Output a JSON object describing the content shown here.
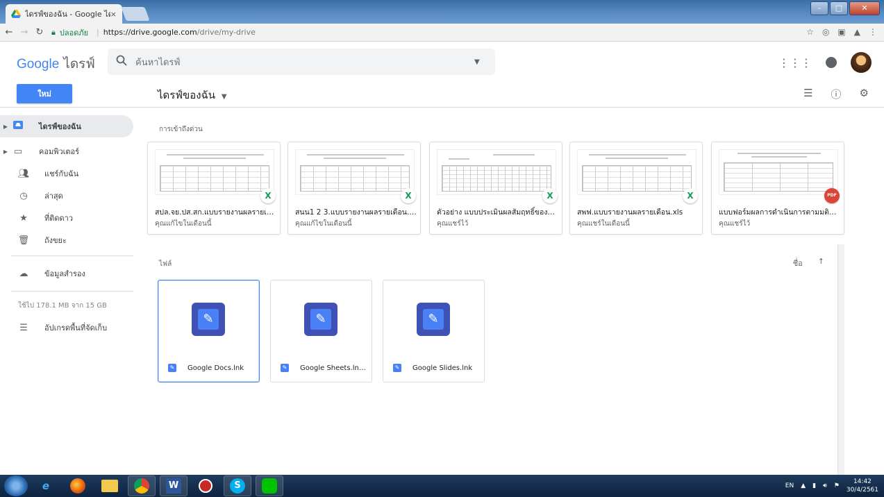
{
  "browser": {
    "tab_title": "ไดรฟ์ของฉัน - Google ไดร",
    "tab_close": "×",
    "secure_label": "ปลอดภัย",
    "url_host": "https://drive.google.com",
    "url_path": "/drive/my-drive"
  },
  "header": {
    "logo_google": "Google",
    "logo_drive": "ไดรฟ์",
    "search_placeholder": "ค้นหาไดรฟ์"
  },
  "toolbar": {
    "new_button": "ใหม่",
    "title": "ไดรฟ์ของฉัน"
  },
  "sidebar": {
    "items": [
      {
        "label": "ไดรฟ์ของฉัน",
        "icon": "drive-icon"
      },
      {
        "label": "คอมพิวเตอร์",
        "icon": "computer-icon"
      },
      {
        "label": "แชร์กับฉัน",
        "icon": "people-icon"
      },
      {
        "label": "ล่าสุด",
        "icon": "clock-icon"
      },
      {
        "label": "ที่ติดดาว",
        "icon": "star-icon"
      },
      {
        "label": "ถังขยะ",
        "icon": "trash-icon"
      }
    ],
    "backup_label": "ข้อมูลสำรอง",
    "storage_text": "ใช้ไป 178.1 MB จาก 15 GB",
    "upgrade_label": "อัปเกรดพื้นที่จัดเก็บ"
  },
  "quick_access": {
    "label": "การเข้าถึงด่วน",
    "cards": [
      {
        "name": "สปล.จย.ปส.สก.แบบรายงานผลรายเดือ...",
        "sub": "คุณแก้ไขในเดือนนี้",
        "badge": "X",
        "type": "sheet"
      },
      {
        "name": "สนน1 2 3.แบบรายงานผลรายเดือน.xls",
        "sub": "คุณแก้ไขในเดือนนี้",
        "badge": "X",
        "type": "sheet"
      },
      {
        "name": "ตัวอย่าง แบบประเมินผลสัมฤทธิ์ของงา...",
        "sub": "คุณแชร์ไว้",
        "badge": "X",
        "type": "sheet"
      },
      {
        "name": "สพฟ.แบบรายงานผลรายเดือน.xls",
        "sub": "คุณแชร์ในเดือนนี้",
        "badge": "X",
        "type": "sheet"
      },
      {
        "name": "แบบฟอร์มผลการดำเนินการตามมติการ...",
        "sub": "คุณแชร์ไว้",
        "badge": "PDF",
        "type": "pdf"
      }
    ]
  },
  "files": {
    "label": "ไฟล์",
    "sort_label": "ชื่อ",
    "sort_arrow": "↑",
    "items": [
      {
        "name": "Google Docs.lnk"
      },
      {
        "name": "Google Sheets.lnk ..."
      },
      {
        "name": "Google Slides.lnk"
      }
    ]
  },
  "taskbar": {
    "lang": "EN",
    "time": "14:42",
    "date": "30/4/2561"
  }
}
